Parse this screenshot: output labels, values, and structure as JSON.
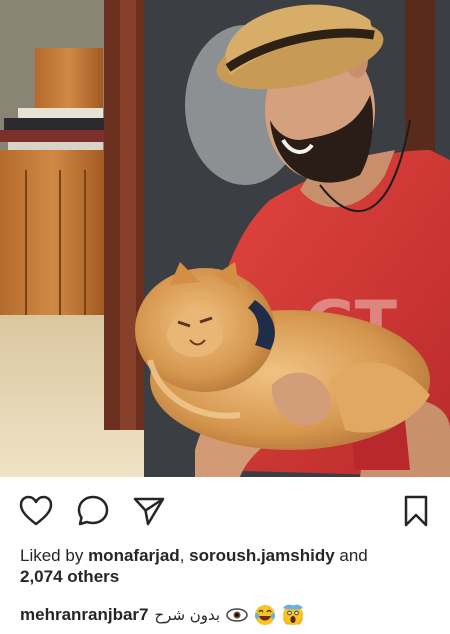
{
  "post": {
    "likes": {
      "prefix": "Liked by",
      "user1": "monafarjad",
      "separator": ",",
      "user2": "soroush.jamshidy",
      "connector": "and",
      "count": "2,074 others"
    },
    "caption": {
      "username": "mehranranjbar7",
      "text": "بدون شرح"
    },
    "icons": {
      "like": "heart-outline-icon",
      "comment": "speech-bubble-icon",
      "share": "paper-plane-icon",
      "save": "bookmark-icon"
    }
  }
}
